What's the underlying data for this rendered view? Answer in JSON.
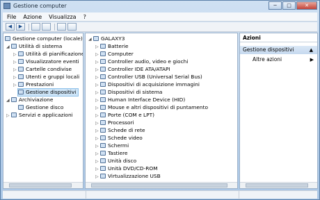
{
  "window": {
    "title": "Gestione computer",
    "min": "─",
    "max": "□",
    "close": "✕"
  },
  "menu": [
    "File",
    "Azione",
    "Visualizza",
    "?"
  ],
  "toolbar": {
    "back": "◀",
    "forward": "▶"
  },
  "tree": {
    "root": "Gestione computer (locale)",
    "system_tools": "Utilità di sistema",
    "scheduler": "Utilità di pianificazione",
    "event_viewer": "Visualizzatore eventi",
    "shared_folders": "Cartelle condivise",
    "users_groups": "Utenti e gruppi locali",
    "performance": "Prestazioni",
    "device_manager": "Gestione dispositivi",
    "storage": "Archiviazione",
    "disk_mgmt": "Gestione disco",
    "services": "Servizi e applicazioni"
  },
  "devices": {
    "computer_name": "GALAXY3",
    "items": [
      "Batterie",
      "Computer",
      "Controller audio, video e giochi",
      "Controller IDE ATA/ATAPI",
      "Controller USB (Universal Serial Bus)",
      "Dispositivi di acquisizione immagini",
      "Dispositivi di sistema",
      "Human Interface Device (HID)",
      "Mouse e altri dispositivi di puntamento",
      "Porte (COM e LPT)",
      "Processori",
      "Schede di rete",
      "Schede video",
      "Schermi",
      "Tastiere",
      "Unità disco",
      "Unità DVD/CD-ROM",
      "Virtualizzazione USB"
    ]
  },
  "actions": {
    "title": "Azioni",
    "section": "Gestione dispositivi",
    "more": "Altre azioni"
  }
}
